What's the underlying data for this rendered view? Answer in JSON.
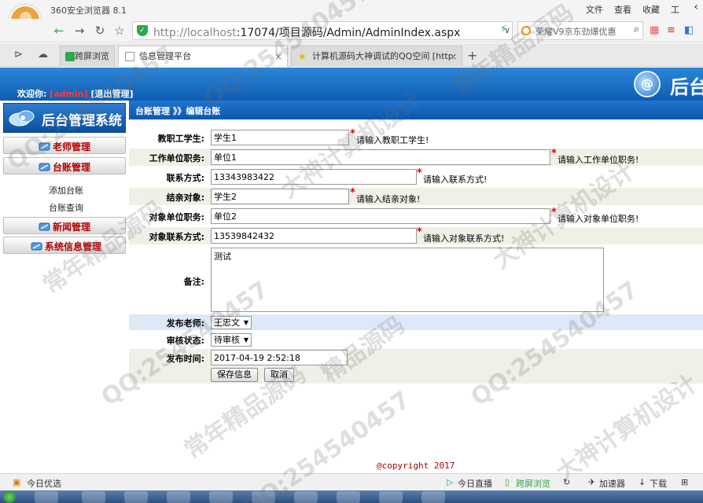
{
  "browser": {
    "app_title": "360安全浏览器 8.1",
    "menu": [
      "文件",
      "查看",
      "收藏",
      "工"
    ],
    "url_host": "http://localhost",
    "url_rest": ":17074/项目源码/Admin/AdminIndex.aspx",
    "search_text": "荣耀V9京东劲爆优惠",
    "tabs": [
      {
        "label": "跨屏浏览"
      },
      {
        "label": "信息管理平台"
      },
      {
        "label": "计算机源码大神调试的QQ空间 [http:"
      }
    ]
  },
  "app": {
    "welcome_prefix": "欢迎你:",
    "username": "[admin]",
    "logout": "[退出管理]",
    "brand": "后台",
    "brand_logo_letter": "@",
    "system_title": "后台管理系统",
    "menu": [
      {
        "label": "老师管理"
      },
      {
        "label": "台账管理"
      },
      {
        "label": "新闻管理"
      },
      {
        "label": "系统信息管理"
      }
    ],
    "submenu": [
      "添加台账",
      "台账查询"
    ],
    "breadcrumb": "台账管理 》》编辑台账"
  },
  "form": {
    "teacher_student": {
      "label": "教职工学生:",
      "value": "学生1",
      "hint": "请输入教职工学生!"
    },
    "work_unit": {
      "label": "工作单位职务:",
      "value": "单位1",
      "hint": "请输入工作单位职务!"
    },
    "contact": {
      "label": "联系方式:",
      "value": "13343983422",
      "hint": "请输入联系方式!"
    },
    "pair_target": {
      "label": "结亲对象:",
      "value": "学生2",
      "hint": "请输入结亲对象!"
    },
    "target_unit": {
      "label": "对象单位职务:",
      "value": "单位2",
      "hint": "请输入对象单位职务!"
    },
    "target_contact": {
      "label": "对象联系方式:",
      "value": "13539842432",
      "hint": "请输入对象联系方式!"
    },
    "remarks": {
      "label": "备注:",
      "value": "测试"
    },
    "publish_teacher": {
      "label": "发布老师:",
      "value": "王忠文"
    },
    "review_status": {
      "label": "审核状态:",
      "value": "待审核"
    },
    "publish_time": {
      "label": "发布时间:",
      "value": "2017-04-19 2:52:18"
    },
    "required_mark": "*",
    "save_label": "保存信息",
    "cancel_label": "取消"
  },
  "copyright": "@copyright 2017",
  "status": {
    "left": "今日优选",
    "live": "今日直播",
    "cross": "跨屏浏览",
    "accelerator": "加速器",
    "download": "下载"
  },
  "watermarks": [
    "QQ:254540457",
    "常年精品源码",
    "大神计算机设计",
    "QQ:254540457",
    "大神计算机设计",
    "常年精品源码",
    "QQ:254540457",
    "精品源码",
    "大神计算机设计",
    "QQ:254540457",
    "常年精品源码",
    "QQ:254540457"
  ],
  "colors": {
    "header_blue": "#0f5db3",
    "menu_red": "#b50000",
    "required_red": "#e00000"
  }
}
